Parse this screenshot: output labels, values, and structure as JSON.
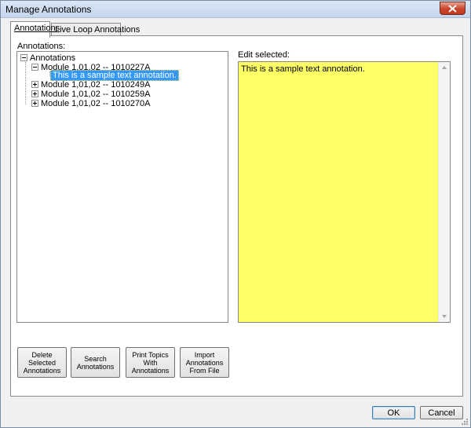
{
  "window": {
    "title": "Manage Annotations"
  },
  "tabs": [
    {
      "label": "Annotations",
      "active": true
    },
    {
      "label": "Live Loop Annotations",
      "active": false
    }
  ],
  "left_panel": {
    "label": "Annotations:"
  },
  "tree": {
    "root": {
      "label": "Annotations",
      "expanded": true
    },
    "modules": [
      {
        "label": "Module 1,01,02 -- 1010227A",
        "expanded": true,
        "children": [
          "This is a sample text annotation."
        ]
      },
      {
        "label": "Module 1,01,02 -- 1010249A",
        "expanded": false
      },
      {
        "label": "Module 1,01,02 -- 1010259A",
        "expanded": false
      },
      {
        "label": "Module 1,01,02 -- 1010270A",
        "expanded": false
      }
    ]
  },
  "right_panel": {
    "label": "Edit selected:",
    "text": "This is a sample text annotation.",
    "background": "#ffff66"
  },
  "actions": [
    {
      "label": "Delete\nSelected\nAnnotations"
    },
    {
      "label": "Search\nAnnotations"
    },
    {
      "label": "Print Topics\nWith\nAnnotations"
    },
    {
      "label": "Import\nAnnotations\nFrom File"
    }
  ],
  "dialog_buttons": {
    "ok": "OK",
    "cancel": "Cancel"
  },
  "colors": {
    "selection": "#3399ff",
    "close_button": "#c9442a"
  }
}
